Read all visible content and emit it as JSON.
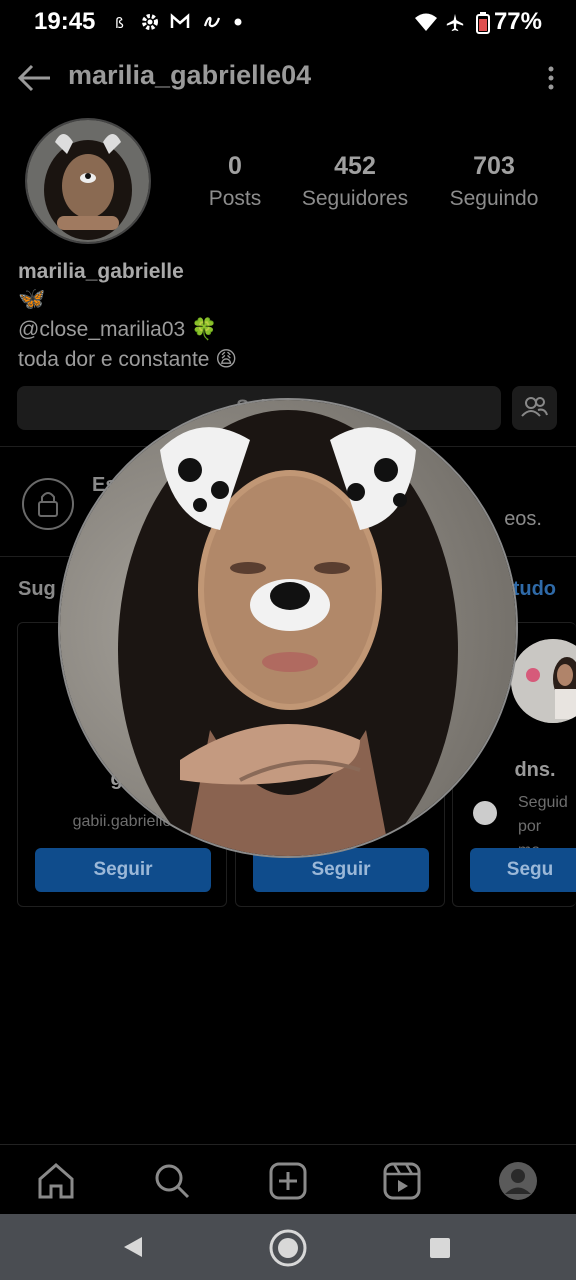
{
  "status_bar": {
    "time": "19:45",
    "battery": "77%"
  },
  "header": {
    "username": "marilia_gabrielle04"
  },
  "profile": {
    "stats": [
      {
        "value": "0",
        "label": "Posts"
      },
      {
        "value": "452",
        "label": "Seguidores"
      },
      {
        "value": "703",
        "label": "Seguindo"
      }
    ],
    "display_name": "marilia_gabrielle",
    "bio_emoji": "🦋",
    "bio_line1": "@close_marilia03 🍀",
    "bio_line2": "toda dor e constante 😩",
    "follow_button": "Sol..."
  },
  "private": {
    "title": "Es",
    "desc": "eos."
  },
  "suggestions": {
    "title": "Sug",
    "see_all": "tudo",
    "cards": [
      {
        "name": "ga",
        "sub": "gabii.gabrielle",
        "button": "Seguir"
      },
      {
        "name": "",
        "sub": "",
        "button": "Seguir"
      },
      {
        "name": "dns.",
        "sub": "Seguid por ma",
        "button": "Segu"
      }
    ]
  },
  "colors": {
    "accent": "#0f4c8c",
    "background": "#000000"
  },
  "icons": [
    "back-arrow-icon",
    "more-vertical-icon",
    "lock-icon",
    "add-people-icon",
    "home-icon",
    "search-icon",
    "create-icon",
    "reels-icon",
    "profile-icon",
    "nav-back-icon",
    "nav-home-icon",
    "nav-recent-icon"
  ]
}
